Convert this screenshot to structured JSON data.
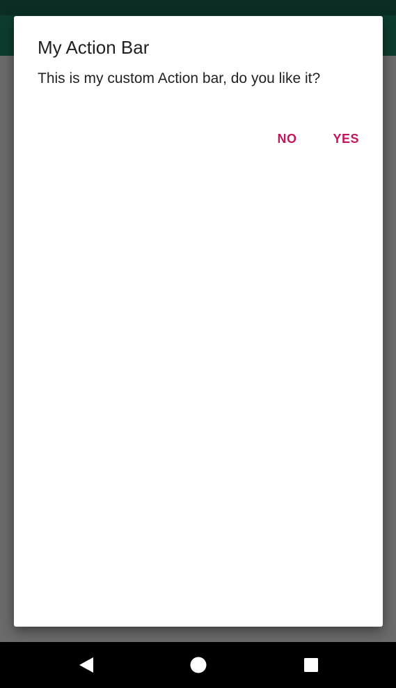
{
  "dialog": {
    "title": "My Action Bar",
    "message": "This is my custom Action bar, do you like it?",
    "negative_label": "NO",
    "positive_label": "YES"
  },
  "colors": {
    "app_bar": "#0d3d30",
    "scrim": "#6b6b6b",
    "accent": "#c2185b",
    "nav_bar": "#000000"
  },
  "nav": {
    "back_icon": "back-triangle-icon",
    "home_icon": "home-circle-icon",
    "recents_icon": "recents-square-icon"
  }
}
